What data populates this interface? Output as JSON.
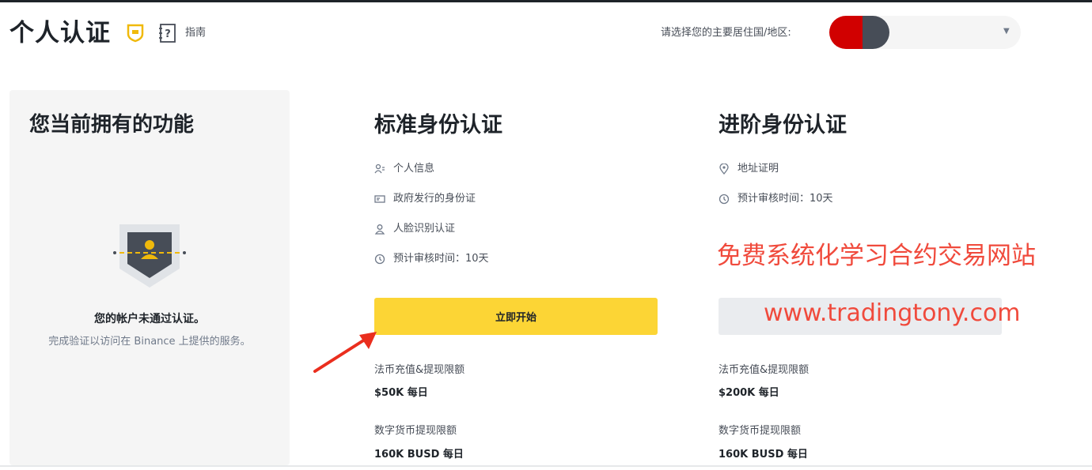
{
  "header": {
    "title": "个人认证",
    "guide_label": "指南",
    "region_label": "请选择您的主要居住国/地区:"
  },
  "left_panel": {
    "title": "您当前拥有的功能",
    "status_title": "您的帐户未通过认证。",
    "status_subtitle": "完成验证以访问在 Binance 上提供的服务。"
  },
  "standard": {
    "title": "标准身份认证",
    "features": [
      {
        "icon": "person-info-icon",
        "label": "个人信息"
      },
      {
        "icon": "id-card-icon",
        "label": "政府发行的身份证"
      },
      {
        "icon": "face-recognition-icon",
        "label": "人脸识别认证"
      },
      {
        "icon": "clock-icon",
        "label": "预计审核时间：10天"
      }
    ],
    "button_label": "立即开始",
    "limits": [
      {
        "label": "法币充值&提现限额",
        "value": "$50K 每日"
      },
      {
        "label": "数字货币提现限额",
        "value": "160K BUSD 每日"
      }
    ]
  },
  "advanced": {
    "title": "进阶身份认证",
    "features": [
      {
        "icon": "location-pin-icon",
        "label": "地址证明"
      },
      {
        "icon": "clock-icon",
        "label": "预计审核时间：10天"
      }
    ],
    "limits": [
      {
        "label": "法币充值&提现限额",
        "value": "$200K 每日"
      },
      {
        "label": "数字货币提现限额",
        "value": "160K BUSD 每日"
      }
    ]
  },
  "watermark": {
    "line1": "免费系统化学习合约交易网站",
    "line2": "www.tradingtony.com"
  },
  "colors": {
    "accent": "#fcd535",
    "shield_icon": "#f0b90b",
    "watermark": "#f04a3c"
  }
}
